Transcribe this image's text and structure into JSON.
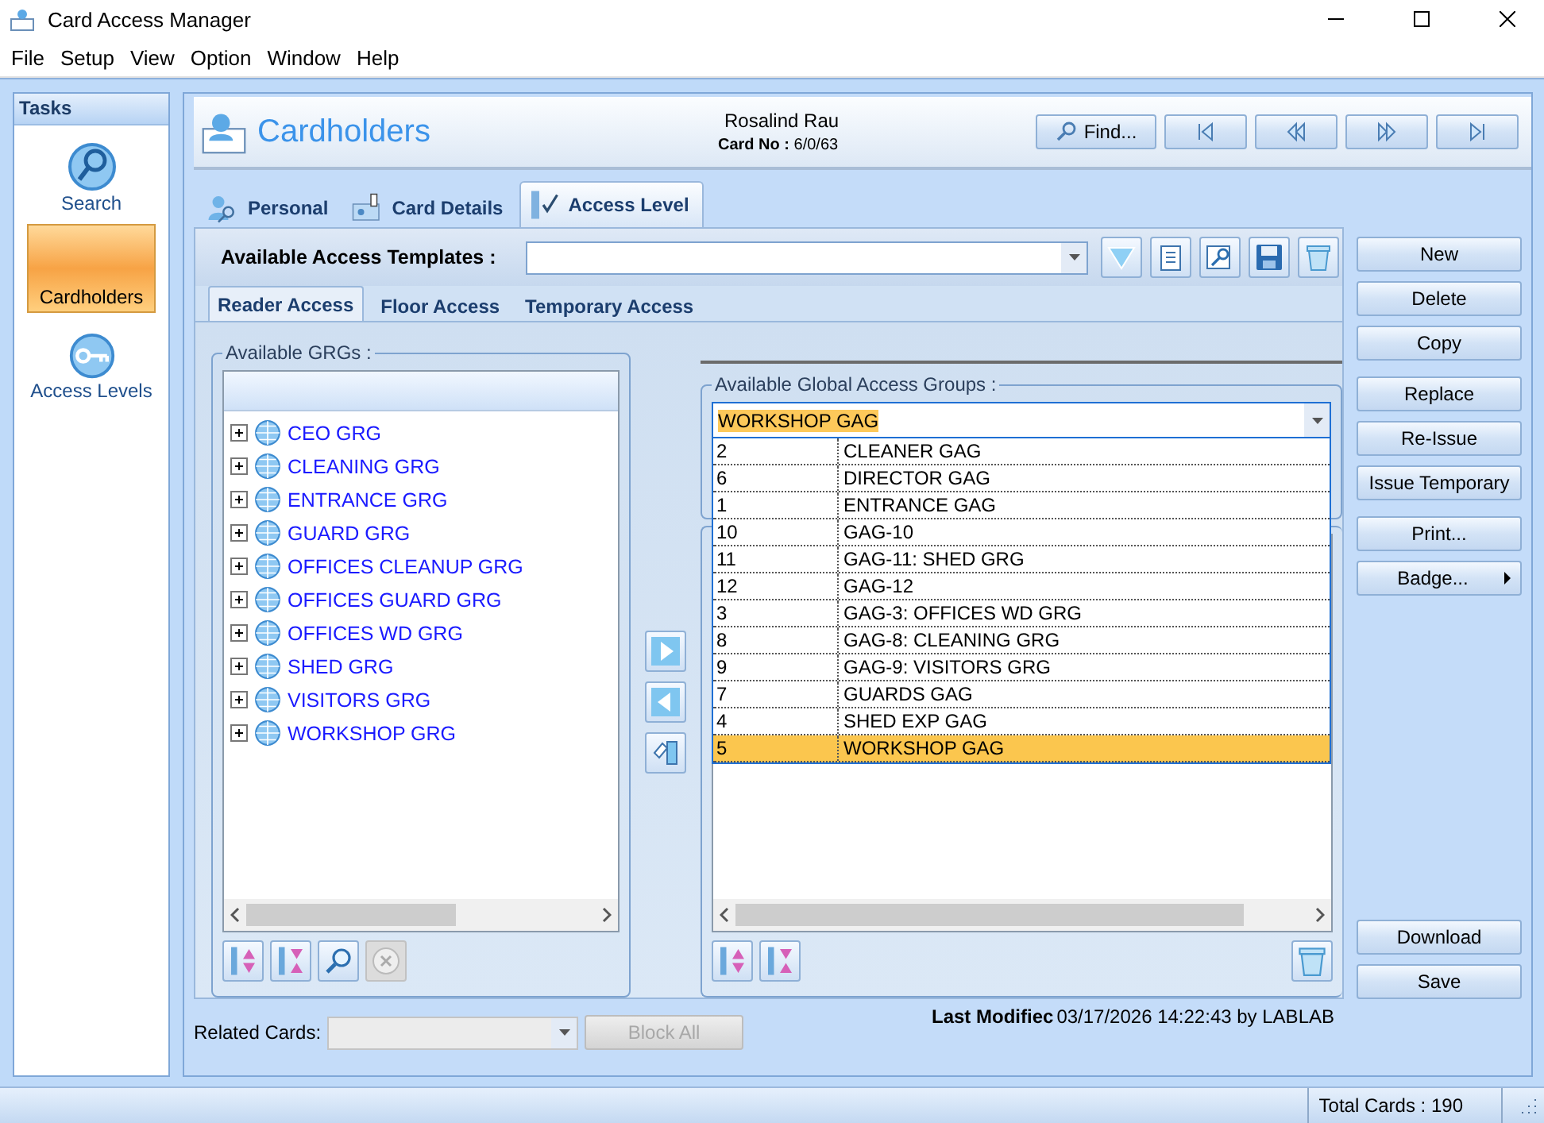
{
  "window": {
    "title": "Card Access Manager"
  },
  "menu": [
    "File",
    "Setup",
    "View",
    "Option",
    "Window",
    "Help"
  ],
  "tasks": {
    "title": "Tasks",
    "items": [
      {
        "label": "Search",
        "selected": false
      },
      {
        "label": "Cardholders",
        "selected": true
      },
      {
        "label": "Access Levels",
        "selected": false
      }
    ]
  },
  "header": {
    "title": "Cardholders",
    "name": "Rosalind Rau",
    "card_no_label": "Card No :",
    "card_no": "6/0/63",
    "find_button": "Find..."
  },
  "tabs": [
    {
      "label": "Personal",
      "selected": false
    },
    {
      "label": "Card Details",
      "selected": false
    },
    {
      "label": "Access Level",
      "selected": true
    }
  ],
  "templates": {
    "label": "Available Access Templates :"
  },
  "sub_tabs": [
    {
      "label": "Reader Access",
      "selected": true
    },
    {
      "label": "Floor Access",
      "selected": false
    },
    {
      "label": "Temporary Access",
      "selected": false
    }
  ],
  "grgs": {
    "label": "Available GRGs :",
    "items": [
      "CEO GRG",
      "CLEANING GRG",
      "ENTRANCE GRG",
      "GUARD GRG",
      "OFFICES CLEANUP GRG",
      "OFFICES GUARD GRG",
      "OFFICES WD GRG",
      "SHED GRG",
      "VISITORS GRG",
      "WORKSHOP GRG"
    ]
  },
  "gags": {
    "label": "Available Global Access Groups :",
    "value": "WORKSHOP GAG",
    "options": [
      {
        "number": "2",
        "name": "CLEANER GAG",
        "selected": false
      },
      {
        "number": "6",
        "name": "DIRECTOR GAG",
        "selected": false
      },
      {
        "number": "1",
        "name": "ENTRANCE GAG",
        "selected": false
      },
      {
        "number": "10",
        "name": "GAG-10",
        "selected": false
      },
      {
        "number": "11",
        "name": "GAG-11: SHED GRG",
        "selected": false
      },
      {
        "number": "12",
        "name": "GAG-12",
        "selected": false
      },
      {
        "number": "3",
        "name": "GAG-3: OFFICES WD GRG",
        "selected": false
      },
      {
        "number": "8",
        "name": "GAG-8: CLEANING GRG",
        "selected": false
      },
      {
        "number": "9",
        "name": "GAG-9: VISITORS GRG",
        "selected": false
      },
      {
        "number": "7",
        "name": "GUARDS GAG",
        "selected": false
      },
      {
        "number": "4",
        "name": "SHED EXP GAG",
        "selected": false
      },
      {
        "number": "5",
        "name": "WORKSHOP GAG",
        "selected": true
      }
    ]
  },
  "action_groups": [
    [
      {
        "label": "New",
        "submenu": false
      },
      {
        "label": "Delete",
        "submenu": false
      },
      {
        "label": "Copy",
        "submenu": false
      }
    ],
    [
      {
        "label": "Replace",
        "submenu": false
      },
      {
        "label": "Re-Issue",
        "submenu": false
      },
      {
        "label": "Issue Temporary",
        "submenu": false
      }
    ],
    [
      {
        "label": "Print...",
        "submenu": false
      },
      {
        "label": "Badge...",
        "submenu": true
      }
    ],
    [
      {
        "label": "Download",
        "submenu": false
      },
      {
        "label": "Save",
        "submenu": false
      }
    ]
  ],
  "last_modified": {
    "label": "Last Modifiec",
    "value": "03/17/2026 14:22:43 by LABLAB"
  },
  "related_cards": {
    "label": "Related Cards:",
    "disabled": true
  },
  "block_all": {
    "label": "Block All",
    "disabled": true
  },
  "status_bar": {
    "total": "Total Cards : 190"
  }
}
